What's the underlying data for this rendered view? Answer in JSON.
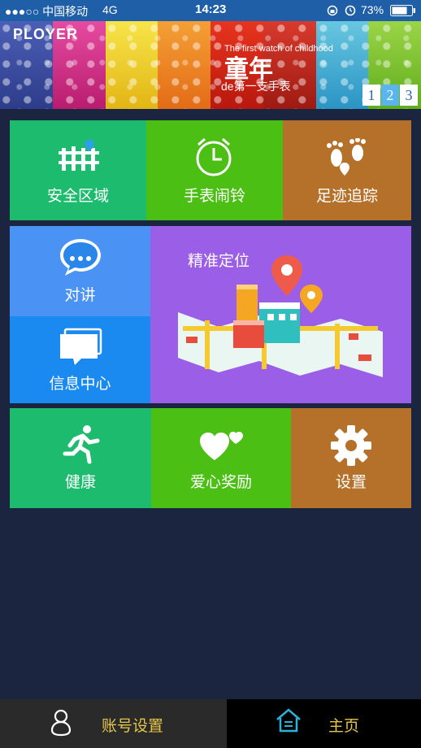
{
  "status_bar": {
    "carrier": "●●●○○ 中国移动",
    "network": "4G",
    "time": "14:23",
    "battery": "73%",
    "icons": [
      "lock-rotation-icon",
      "alarm-icon",
      "battery-icon"
    ]
  },
  "banner": {
    "logo": "PLOYER",
    "subtitle": "The first watch of childhood",
    "title": "童年",
    "tagline": "de第一支手表",
    "pages": [
      "1",
      "2",
      "3"
    ],
    "active_page": "2"
  },
  "tiles": {
    "safe_zone": {
      "label": "安全区域",
      "icon": "fence-pin-icon",
      "color": "#1dbb6d"
    },
    "watch_alarm": {
      "label": "手表闹铃",
      "icon": "alarm-clock-icon",
      "color": "#4bbf14"
    },
    "footprint": {
      "label": "足迹追踪",
      "icon": "footprints-icon",
      "color": "#b5712a"
    },
    "intercom": {
      "label": "对讲",
      "icon": "chat-bubble-icon",
      "color": "#4a93f5"
    },
    "messages": {
      "label": "信息中心",
      "icon": "message-stack-icon",
      "color": "#1a8af0"
    },
    "location": {
      "label": "精准定位",
      "icon": "city-map-icon",
      "color": "#9a5fe6"
    },
    "health": {
      "label": "健康",
      "icon": "running-man-icon",
      "color": "#1dbb6d"
    },
    "love_reward": {
      "label": "爱心奖励",
      "icon": "hearts-icon",
      "color": "#4bbf14"
    },
    "settings": {
      "label": "设置",
      "icon": "gear-icon",
      "color": "#b5712a"
    }
  },
  "tab_bar": {
    "account": {
      "label": "账号设置",
      "icon": "person-icon"
    },
    "home": {
      "label": "主页",
      "icon": "home-icon"
    }
  },
  "colors": {
    "background": "#1b2540",
    "status_bar": "#1f5fa8",
    "tab_label": "#e6c64a",
    "tab_home_icon": "#2ab3d6"
  }
}
